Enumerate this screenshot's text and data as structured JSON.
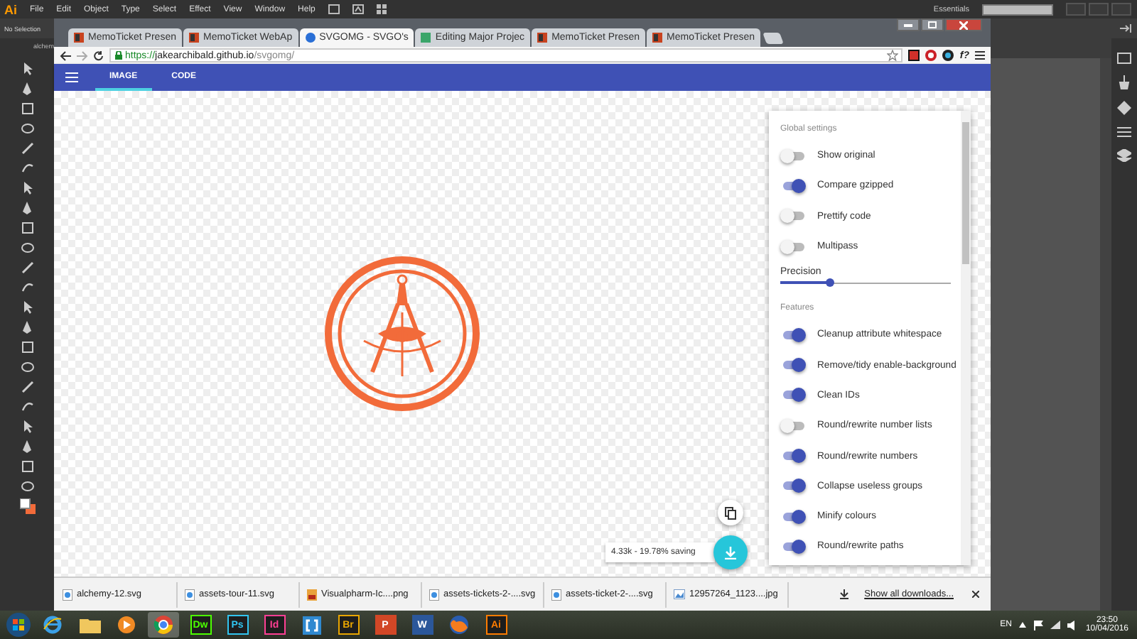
{
  "illustrator": {
    "logo": "Ai",
    "menu": [
      "File",
      "Edit",
      "Object",
      "Type",
      "Select",
      "Effect",
      "View",
      "Window",
      "Help"
    ],
    "workspace": "Essentials",
    "selection": "No Selection",
    "document_tab": "alchem"
  },
  "browser": {
    "tabs": [
      {
        "title": "MemoTicket Presen",
        "kind": "slides",
        "selected": false
      },
      {
        "title": "MemoTicket WebAp",
        "kind": "slides",
        "selected": false
      },
      {
        "title": "SVGOMG - SVGO's",
        "kind": "globe",
        "selected": true
      },
      {
        "title": "Editing Major Projec",
        "kind": "doc",
        "selected": false
      },
      {
        "title": "MemoTicket Presen",
        "kind": "slides",
        "selected": false
      },
      {
        "title": "MemoTicket Presen",
        "kind": "slides",
        "selected": false
      }
    ],
    "address": {
      "scheme": "https://",
      "host": "jakearchibald.github.io",
      "path": "/svgomg/"
    },
    "extension_label": "f?",
    "app_tabs": [
      {
        "label": "IMAGE",
        "selected": true
      },
      {
        "label": "CODE",
        "selected": false
      }
    ],
    "settings": {
      "global_heading": "Global settings",
      "global": [
        {
          "label": "Show original",
          "on": false
        },
        {
          "label": "Compare gzipped",
          "on": true
        },
        {
          "label": "Prettify code",
          "on": false
        },
        {
          "label": "Multipass",
          "on": false
        }
      ],
      "precision": {
        "label": "Precision",
        "level": 0.29
      },
      "features_heading": "Features",
      "features": [
        {
          "label": "Cleanup attribute whitespace",
          "on": true
        },
        {
          "label": "Remove/tidy enable-background",
          "on": true
        },
        {
          "label": "Clean IDs",
          "on": true
        },
        {
          "label": "Round/rewrite number lists",
          "on": false
        },
        {
          "label": "Round/rewrite numbers",
          "on": true
        },
        {
          "label": "Collapse useless groups",
          "on": true
        },
        {
          "label": "Minify colours",
          "on": true
        },
        {
          "label": "Round/rewrite paths",
          "on": true
        }
      ]
    },
    "result": "4.33k - 19.78% saving",
    "downloads": {
      "items": [
        {
          "name": "alchemy-12.svg",
          "kind": "svg"
        },
        {
          "name": "assets-tour-11.svg",
          "kind": "svg"
        },
        {
          "name": "Visualpharm-Ic....png",
          "kind": "png"
        },
        {
          "name": "assets-tickets-2-....svg",
          "kind": "svg"
        },
        {
          "name": "assets-ticket-2-....svg",
          "kind": "svg"
        },
        {
          "name": "12957264_1123....jpg",
          "kind": "jpg"
        }
      ],
      "show_all": "Show all downloads..."
    }
  },
  "taskbar": {
    "apps": [
      {
        "kind": "ie",
        "selected": false
      },
      {
        "kind": "folder",
        "selected": false
      },
      {
        "kind": "player",
        "selected": false
      },
      {
        "kind": "chrome",
        "selected": true
      },
      {
        "kind": "adobe",
        "label": "Dw",
        "color": "#4cff00",
        "selected": false
      },
      {
        "kind": "adobe",
        "label": "Ps",
        "color": "#31c5f0",
        "selected": false
      },
      {
        "kind": "adobe",
        "label": "Id",
        "color": "#ff3f94",
        "selected": false
      },
      {
        "kind": "brackets",
        "selected": false
      },
      {
        "kind": "adobe",
        "label": "Br",
        "color": "#e9a600",
        "selected": false
      },
      {
        "kind": "office",
        "label": "P",
        "color": "#d24726",
        "selected": false
      },
      {
        "kind": "office",
        "label": "W",
        "color": "#2b579a",
        "selected": false
      },
      {
        "kind": "firefox",
        "selected": false
      },
      {
        "kind": "adobe",
        "label": "Ai",
        "color": "#ff7c00",
        "selected": false
      }
    ],
    "language": "EN",
    "time": "23:50",
    "date": "10/04/2016"
  }
}
